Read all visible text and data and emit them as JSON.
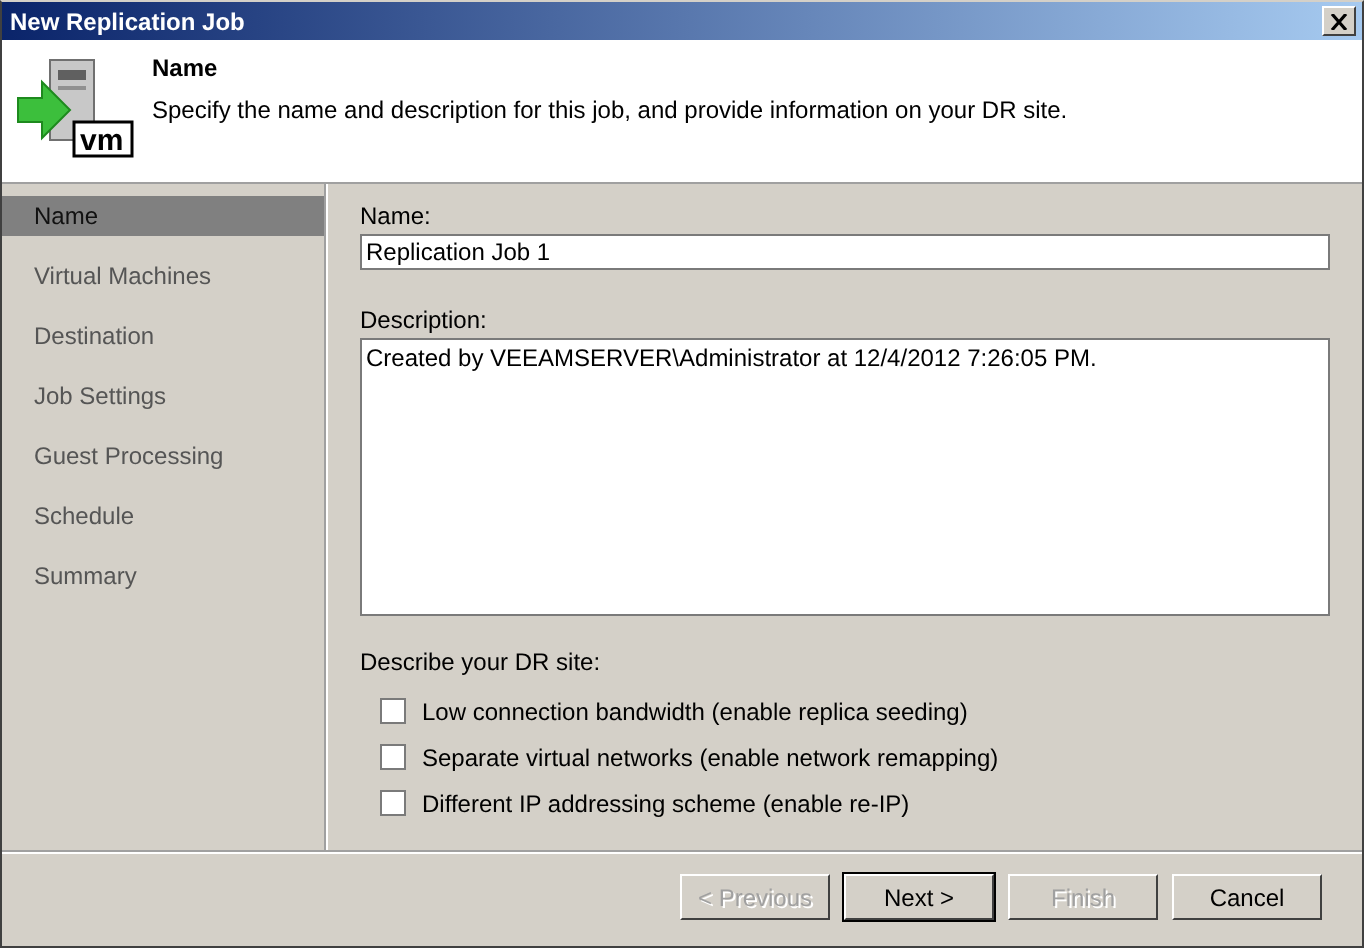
{
  "window": {
    "title": "New Replication Job"
  },
  "header": {
    "icon_label": "vm",
    "title": "Name",
    "description": "Specify the name and description for this job, and provide information on your DR site."
  },
  "steps": [
    {
      "label": "Name",
      "selected": true
    },
    {
      "label": "Virtual Machines",
      "selected": false
    },
    {
      "label": "Destination",
      "selected": false
    },
    {
      "label": "Job Settings",
      "selected": false
    },
    {
      "label": "Guest Processing",
      "selected": false
    },
    {
      "label": "Schedule",
      "selected": false
    },
    {
      "label": "Summary",
      "selected": false
    }
  ],
  "name_field": {
    "label": "Name:",
    "value": "Replication Job 1"
  },
  "description_field": {
    "label": "Description:",
    "value": "Created by VEEAMSERVER\\Administrator at 12/4/2012 7:26:05 PM."
  },
  "dr_site": {
    "label": "Describe your DR site:",
    "options": [
      {
        "label": "Low connection bandwidth (enable replica seeding)",
        "checked": false
      },
      {
        "label": "Separate virtual networks (enable network remapping)",
        "checked": false
      },
      {
        "label": "Different IP addressing scheme (enable re-IP)",
        "checked": false
      }
    ]
  },
  "buttons": [
    {
      "label": "< Previous",
      "disabled": true,
      "default": false
    },
    {
      "label": "Next >",
      "disabled": false,
      "default": true
    },
    {
      "label": "Finish",
      "disabled": true,
      "default": false
    },
    {
      "label": "Cancel",
      "disabled": false,
      "default": false
    }
  ]
}
